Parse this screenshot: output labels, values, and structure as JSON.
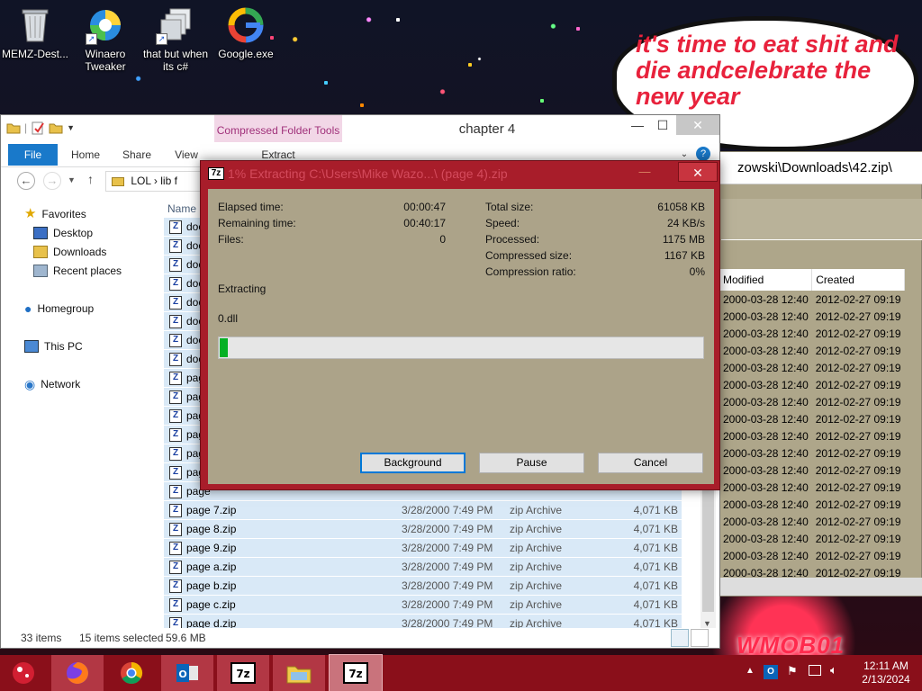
{
  "desktop": {
    "icons": [
      {
        "label": "MEMZ-Dest...",
        "icon": "recycle-bin-icon"
      },
      {
        "label": "Winaero Tweaker",
        "icon": "winaero-icon"
      },
      {
        "label": "that but when its c#",
        "icon": "windows-shortcut-icon"
      },
      {
        "label": "Google.exe",
        "icon": "google-icon"
      }
    ],
    "speech_text": "it's time to eat shit and die andcelebrate the new year",
    "watermark_text": "WMOB01"
  },
  "second_window": {
    "address": "zowski\\Downloads\\42.zip\\",
    "columns": [
      "Modified",
      "Created"
    ],
    "rows": [
      {
        "modified": "2000-03-28 12:40",
        "created": "2012-02-27 09:19"
      },
      {
        "modified": "2000-03-28 12:40",
        "created": "2012-02-27 09:19"
      },
      {
        "modified": "2000-03-28 12:40",
        "created": "2012-02-27 09:19"
      },
      {
        "modified": "2000-03-28 12:40",
        "created": "2012-02-27 09:19"
      },
      {
        "modified": "2000-03-28 12:40",
        "created": "2012-02-27 09:19"
      },
      {
        "modified": "2000-03-28 12:40",
        "created": "2012-02-27 09:19"
      },
      {
        "modified": "2000-03-28 12:40",
        "created": "2012-02-27 09:19"
      },
      {
        "modified": "2000-03-28 12:40",
        "created": "2012-02-27 09:19"
      },
      {
        "modified": "2000-03-28 12:40",
        "created": "2012-02-27 09:19"
      },
      {
        "modified": "2000-03-28 12:40",
        "created": "2012-02-27 09:19"
      },
      {
        "modified": "2000-03-28 12:40",
        "created": "2012-02-27 09:19"
      },
      {
        "modified": "2000-03-28 12:40",
        "created": "2012-02-27 09:19"
      },
      {
        "modified": "2000-03-28 12:40",
        "created": "2012-02-27 09:19"
      },
      {
        "modified": "2000-03-28 12:40",
        "created": "2012-02-27 09:19"
      },
      {
        "modified": "2000-03-28 12:40",
        "created": "2012-02-27 09:19"
      },
      {
        "modified": "2000-03-28 12:40",
        "created": "2012-02-27 09:19"
      },
      {
        "modified": "2000-03-28 12:40",
        "created": "2012-02-27 09:19"
      }
    ]
  },
  "explorer": {
    "title": "chapter 4",
    "context_tab": "Compressed Folder Tools",
    "tabs": {
      "file": "File",
      "home": "Home",
      "share": "Share",
      "view": "View",
      "extract": "Extract"
    },
    "address": "LOL  ›  lib f",
    "nav": {
      "favorites": "Favorites",
      "desktop": "Desktop",
      "downloads": "Downloads",
      "recent": "Recent places",
      "homegroup": "Homegroup",
      "thispc": "This PC",
      "network": "Network"
    },
    "column_name": "Name",
    "hidden_rows": [
      "doc",
      "doc",
      "doc",
      "doc",
      "doc",
      "doc",
      "doc",
      "doc",
      "page",
      "page",
      "page",
      "page",
      "page",
      "page",
      "page"
    ],
    "files": [
      {
        "name": "page 7.zip",
        "date": "3/28/2000 7:49 PM",
        "type": "zip Archive",
        "size": "4,071 KB"
      },
      {
        "name": "page 8.zip",
        "date": "3/28/2000 7:49 PM",
        "type": "zip Archive",
        "size": "4,071 KB"
      },
      {
        "name": "page 9.zip",
        "date": "3/28/2000 7:49 PM",
        "type": "zip Archive",
        "size": "4,071 KB"
      },
      {
        "name": "page a.zip",
        "date": "3/28/2000 7:49 PM",
        "type": "zip Archive",
        "size": "4,071 KB"
      },
      {
        "name": "page b.zip",
        "date": "3/28/2000 7:49 PM",
        "type": "zip Archive",
        "size": "4,071 KB"
      },
      {
        "name": "page c.zip",
        "date": "3/28/2000 7:49 PM",
        "type": "zip Archive",
        "size": "4,071 KB"
      },
      {
        "name": "page d.zip",
        "date": "3/28/2000 7:49 PM",
        "type": "zip Archive",
        "size": "4,071 KB"
      }
    ],
    "status": {
      "items": "33 items",
      "selected": "15 items selected",
      "size": "59.6 MB"
    }
  },
  "zip_dialog": {
    "title": "1% Extracting C:\\Users\\Mike Wazo...\\ (page 4).zip",
    "left": [
      {
        "label": "Elapsed time:",
        "value": "00:00:47"
      },
      {
        "label": "Remaining time:",
        "value": "00:40:17"
      },
      {
        "label": "Files:",
        "value": "0"
      }
    ],
    "right": [
      {
        "label": "Total size:",
        "value": "61058 KB"
      },
      {
        "label": "Speed:",
        "value": "24 KB/s"
      },
      {
        "label": "Processed:",
        "value": "1175 MB"
      },
      {
        "label": "Compressed size:",
        "value": "1167 KB"
      },
      {
        "label": "Compression ratio:",
        "value": "0%"
      }
    ],
    "status": "Extracting",
    "current_file": "0.dll",
    "progress_fraction": 0.017,
    "buttons": {
      "background": "Background",
      "pause": "Pause",
      "cancel": "Cancel"
    }
  },
  "taskbar": {
    "items": [
      "firefox-icon",
      "chrome-icon",
      "outlook-icon",
      "7zip-icon",
      "explorer-icon",
      "7zip-icon"
    ],
    "time": "12:11 AM",
    "date": "2/13/2024"
  },
  "colors": {
    "accent": "#1979ca",
    "dialog_frame": "#a81d2a",
    "progress": "#06b025",
    "taskbar": "#8a0f1a"
  }
}
